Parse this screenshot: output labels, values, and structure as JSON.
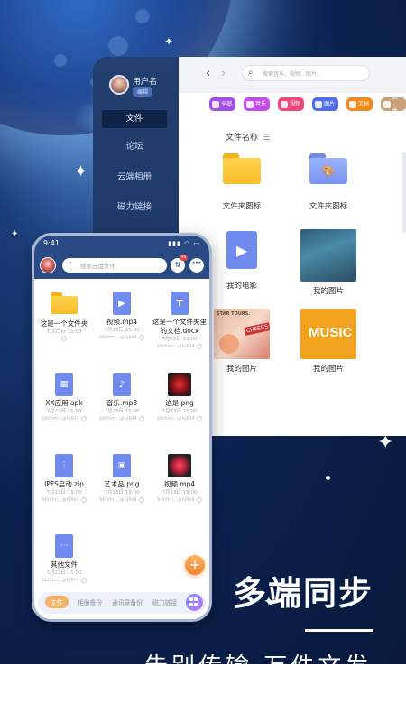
{
  "tablet": {
    "user": {
      "name": "用户名",
      "edit": "编辑"
    },
    "nav": [
      "文件",
      "论坛",
      "云端相册",
      "磁力链接"
    ],
    "nav_active_index": 0,
    "search_placeholder": "搜索音乐、视频、图片...",
    "chips": [
      {
        "label": "全部",
        "color": "#a44ee8"
      },
      {
        "label": "音乐",
        "color": "#c24ce6"
      },
      {
        "label": "视频",
        "color": "#f0477a"
      },
      {
        "label": "图片",
        "color": "#4f6ee8"
      },
      {
        "label": "文档",
        "color": "#f08a1c"
      },
      {
        "label": "其他",
        "color": "#c9a17a"
      }
    ],
    "column_header": "文件名称",
    "items": [
      {
        "label": "文件夹图标",
        "kind": "folder-yellow"
      },
      {
        "label": "文件夹图标",
        "kind": "folder-blue"
      },
      {
        "label": "我的电影",
        "kind": "video-doc"
      },
      {
        "label": "我的图片",
        "kind": "thumb-teal"
      },
      {
        "label": "我的图片",
        "kind": "thumb-peach"
      },
      {
        "label": "我的图片",
        "kind": "thumb-music"
      }
    ],
    "thumb_texts": {
      "peach_top": "STAR TOURS.",
      "peach_tag": "CHEERS",
      "music": "MUSIC"
    }
  },
  "phone": {
    "time": "9:41",
    "search_placeholder": "搜索云盘文件",
    "badge": "99",
    "items": [
      {
        "name": "这是一个文件夹",
        "date": "7月23日 15:00",
        "hash": "",
        "kind": "folder"
      },
      {
        "name": "视频.mp4",
        "date": "7月23日 15:00",
        "hash": "fdhhfm...grkjfkl4",
        "kind": "video"
      },
      {
        "name": "这是一个文件夹里的文档.docx",
        "date": "7月23日 15:00",
        "hash": "fdhhfm...grkjfkl4",
        "kind": "doc"
      },
      {
        "name": "XX应用.apk",
        "date": "7月23日 15:00",
        "hash": "fdhhfm...grkjfkl4",
        "kind": "apk"
      },
      {
        "name": "音乐.mp3",
        "date": "7月23日 15:00",
        "hash": "fdhhfm...grkjfkl4",
        "kind": "music"
      },
      {
        "name": "这是.png",
        "date": "7月23日 15:00",
        "hash": "fdhhfm...grkjfkl4",
        "kind": "png-red"
      },
      {
        "name": "IPFS启动.zip",
        "date": "7月23日 15:00",
        "hash": "fdhhfm...grkjfkl4",
        "kind": "zip"
      },
      {
        "name": "艺术品.png",
        "date": "7月23日 15:00",
        "hash": "fdhhfm...grkjfkl4",
        "kind": "image"
      },
      {
        "name": "视频.mp4",
        "date": "7月23日 15:00",
        "hash": "fdhhfm...grkjfkl4",
        "kind": "video-thumb"
      },
      {
        "name": "其他文件",
        "date": "7月23日 15:00",
        "hash": "fdhhfm...grkjfkl4",
        "kind": "other"
      }
    ],
    "bottom_tabs": [
      "文件",
      "相册备份",
      "通讯录备份",
      "磁力链接"
    ],
    "active_tab_index": 0
  },
  "headline": "多端同步",
  "subline": "告别传输 万件文发"
}
